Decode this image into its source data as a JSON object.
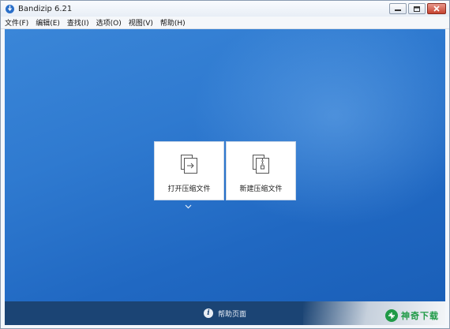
{
  "window": {
    "title": "Bandizip 6.21"
  },
  "menu": [
    "文件(F)",
    "编辑(E)",
    "查找(I)",
    "选项(O)",
    "视图(V)",
    "帮助(H)"
  ],
  "tiles": {
    "open_label": "打开压缩文件",
    "new_label": "新建压缩文件"
  },
  "footer": {
    "help_label": "帮助页面",
    "info_glyph": "i"
  },
  "watermark": {
    "text": "神奇下载"
  },
  "colors": {
    "main_bg": "#2f7ad0",
    "footer_bg": "#1b4474",
    "tile_bg": "#ffffff",
    "watermark": "#1f9a46"
  },
  "icons": [
    "app-icon",
    "minimize-icon",
    "maximize-icon",
    "close-icon",
    "open-archive-icon",
    "new-archive-icon",
    "chevron-down-icon",
    "info-icon",
    "watermark-logo-icon"
  ]
}
